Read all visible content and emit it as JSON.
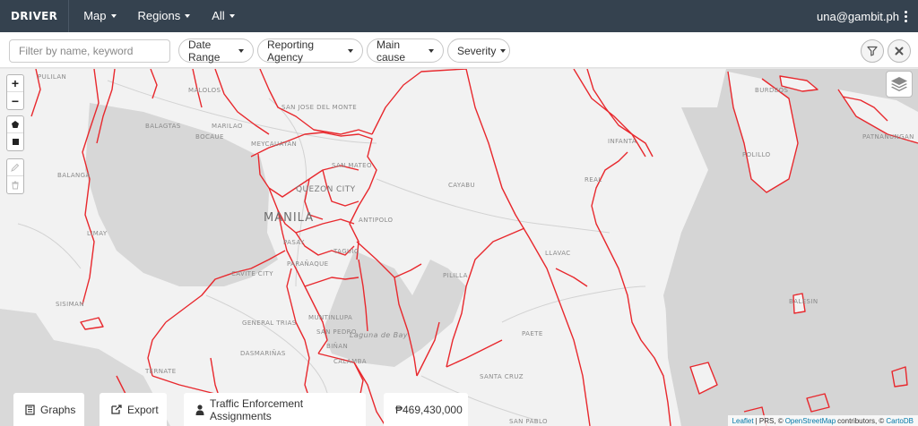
{
  "navbar": {
    "brand": "DRIVER",
    "menus": [
      {
        "label": "Map"
      },
      {
        "label": "Regions"
      },
      {
        "label": "All"
      }
    ],
    "user": "una@gambit.ph"
  },
  "filters": {
    "search_placeholder": "Filter by name, keyword",
    "dropdowns": [
      {
        "label": "Date Range"
      },
      {
        "label": "Reporting Agency"
      },
      {
        "label": "Main cause"
      },
      {
        "label": "Severity"
      }
    ]
  },
  "map": {
    "zoom_in": "+",
    "zoom_out": "−",
    "labels": {
      "manila": "MANILA",
      "quezon_city": "QUEZON CITY",
      "meycauayan": "MEYCAUAYAN",
      "san_mateo": "SAN MATEO",
      "antipolo": "ANTIPOLO",
      "pasay": "PASAY",
      "paranaque": "PARAÑAQUE",
      "taguig": "TAGUIG",
      "muntinlupa": "MUNTINLUPA",
      "san_pedro": "SAN PEDRO",
      "binan": "BIÑAN",
      "cavite_city": "CAVITE CITY",
      "general_trias": "GENERAL TRIAS",
      "dasmarinas": "DASMARIÑAS",
      "calamba": "CALAMBA",
      "santa_cruz": "SANTA CRUZ",
      "san_pablo": "SAN PABLO",
      "pililla": "PILILLA",
      "paete": "PAETE",
      "llavac": "LLAVAC",
      "infanta": "INFANTA",
      "real": "REAL",
      "cayabu": "CAYABU",
      "malolos": "MALOLOS",
      "san_jose_del_monte": "SAN JOSE DEL MONTE",
      "pulilan": "PULILAN",
      "balanga": "BALANGA",
      "limay": "LIMAY",
      "sisiman": "SISIMAN",
      "ternate": "TERNATE",
      "burdeos": "BURDEOS",
      "polillo": "POLILLO",
      "patnanungan": "PATNANUNGAN",
      "balesin": "BALESIN",
      "laguna_de_bay": "Laguna de Bay",
      "balagtas": "BALAGTAS",
      "bocaue": "BOCAUE",
      "marilao": "MARILAO",
      "pulilan2": "PULILAN"
    },
    "boundary_color": "#e8282d"
  },
  "bottom": {
    "graphs": "Graphs",
    "export": "Export",
    "traffic": "Traffic Enforcement Assignments",
    "cost": "₱469,430,000"
  },
  "attribution": {
    "leaflet": "Leaflet",
    "sep1": " | PRS, © ",
    "osm": "OpenStreetMap",
    "sep2": " contributors, © ",
    "carto": "CartoDB"
  }
}
